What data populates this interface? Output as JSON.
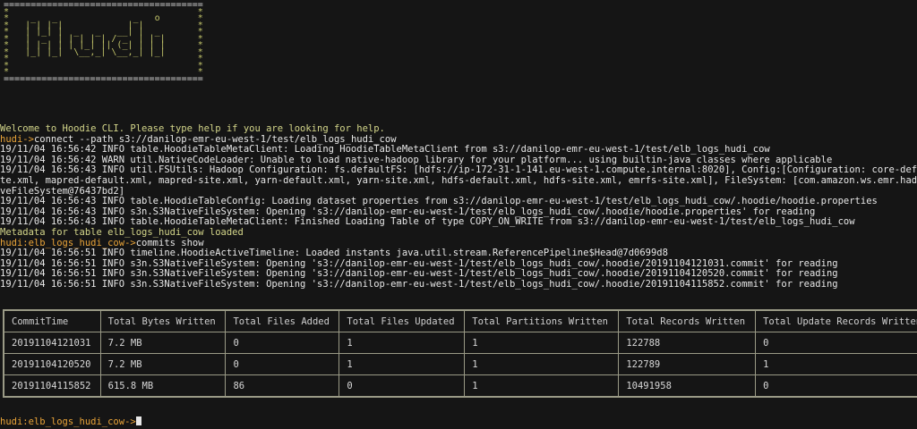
{
  "terminal": {
    "banner_top": "=====================================",
    "banner_logo_rows": [
      "*                                   *",
      "*    _   _              _   o       *",
      "*   | | | |            | |          *",
      "*   | |_| |  _   _   __| |  _       *",
      "*   |  _  | | | | | / _  | | |      *",
      "*   | | | | | |_| || (_| | | |      *",
      "*   |_| |_|  \\__,_| \\__,_| |_|      *",
      "*                                   *",
      "*                                   *",
      "*                                   *"
    ],
    "banner_bottom": "=====================================",
    "welcome": "Welcome to Hoodie CLI. Please type help if you are looking for help.",
    "prompt1": "hudi->",
    "command1": "connect --path s3://danilop-emr-eu-west-1/test/elb_logs_hudi_cow",
    "log_lines_1": [
      "19/11/04 16:56:42 INFO table.HoodieTableMetaClient: Loading HoodieTableMetaClient from s3://danilop-emr-eu-west-1/test/elb_logs_hudi_cow",
      "19/11/04 16:56:42 WARN util.NativeCodeLoader: Unable to load native-hadoop library for your platform... using builtin-java classes where applicable",
      "19/11/04 16:56:43 INFO util.FSUtils: Hadoop Configuration: fs.defaultFS: [hdfs://ip-172-31-1-141.eu-west-1.compute.internal:8020], Config:[Configuration: core-defa",
      "te.xml, mapred-default.xml, mapred-site.xml, yarn-default.xml, yarn-site.xml, hdfs-default.xml, hdfs-site.xml, emrfs-site.xml], FileSystem: [com.amazon.ws.emr.hado",
      "veFileSystem@76437bd2]",
      "19/11/04 16:56:43 INFO table.HoodieTableConfig: Loading dataset properties from s3://danilop-emr-eu-west-1/test/elb_logs_hudi_cow/.hoodie/hoodie.properties",
      "19/11/04 16:56:43 INFO s3n.S3NativeFileSystem: Opening 's3://danilop-emr-eu-west-1/test/elb_logs_hudi_cow/.hoodie/hoodie.properties' for reading",
      "19/11/04 16:56:43 INFO table.HoodieTableMetaClient: Finished Loading Table of type COPY_ON_WRITE from s3://danilop-emr-eu-west-1/test/elb_logs_hudi_cow"
    ],
    "metadata_msg": "Metadata for table elb_logs_hudi_cow loaded",
    "prompt2": "hudi:elb_logs_hudi_cow->",
    "command2": "commits show",
    "log_lines_2": [
      "19/11/04 16:56:51 INFO timeline.HoodieActiveTimeline: Loaded instants java.util.stream.ReferencePipeline$Head@7d0699d8",
      "19/11/04 16:56:51 INFO s3n.S3NativeFileSystem: Opening 's3://danilop-emr-eu-west-1/test/elb_logs_hudi_cow/.hoodie/20191104121031.commit' for reading",
      "19/11/04 16:56:51 INFO s3n.S3NativeFileSystem: Opening 's3://danilop-emr-eu-west-1/test/elb_logs_hudi_cow/.hoodie/20191104120520.commit' for reading",
      "19/11/04 16:56:51 INFO s3n.S3NativeFileSystem: Opening 's3://danilop-emr-eu-west-1/test/elb_logs_hudi_cow/.hoodie/20191104115852.commit' for reading"
    ],
    "final_prompt": "hudi:elb_logs_hudi_cow->"
  },
  "table": {
    "headers": [
      "CommitTime",
      "Total Bytes Written",
      "Total Files Added",
      "Total Files Updated",
      "Total Partitions Written",
      "Total Records Written",
      "Total Update Records Written"
    ],
    "rows": [
      [
        "20191104121031",
        "7.2 MB",
        "0",
        "1",
        "1",
        "122788",
        "0"
      ],
      [
        "20191104120520",
        "7.2 MB",
        "0",
        "1",
        "1",
        "122789",
        "1"
      ],
      [
        "20191104115852",
        "615.8 MB",
        "86",
        "0",
        "1",
        "10491958",
        "0"
      ]
    ]
  },
  "colors": {
    "background": "#151515",
    "prompt": "#e8a338",
    "logo": "#c2c46a"
  }
}
